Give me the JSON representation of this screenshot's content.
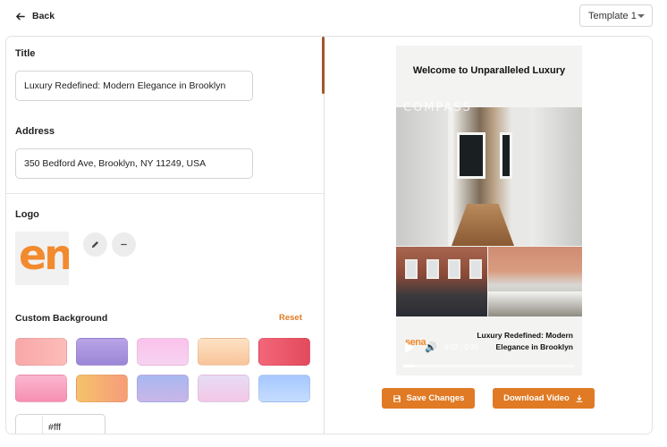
{
  "header": {
    "back_label": "Back",
    "template_value": "Template 1"
  },
  "form": {
    "title_label": "Title",
    "title_value": "Luxury Redefined: Modern Elegance in Brooklyn",
    "address_label": "Address",
    "address_value": "350 Bedford Ave, Brooklyn, NY 11249, USA",
    "logo_label": "Logo",
    "logo_text": "en",
    "custom_bg_label": "Custom Background",
    "reset_label": "Reset",
    "color_value": "#fff",
    "swatches": [
      "linear-gradient(90deg,#f7a8a8,#fdbcb8)",
      "linear-gradient(180deg,#b9a4e8,#9a86d6)",
      "linear-gradient(180deg,#fbc2eb,#f6d3f0)",
      "linear-gradient(180deg,#fde2c4,#f8c49a)",
      "linear-gradient(90deg,#f3667a,#e24b5c)",
      "linear-gradient(180deg,#fbb6ce,#f78fb3)",
      "linear-gradient(90deg,#f5c26b,#f79c7a)",
      "linear-gradient(180deg,#a8b8f0,#c9b5e8)",
      "linear-gradient(180deg,#e6dcf5,#f3c7e6)",
      "linear-gradient(180deg,#a6c8ff,#c5dcff)"
    ]
  },
  "preview": {
    "title": "Welcome to Unparalleled Luxury",
    "watermark": "COMPASS",
    "caption": "Luxury Redefined: Modern Elegance in Brooklyn",
    "logo_text": "sena",
    "time": "0:02 / 0:30",
    "progress": 0.07
  },
  "actions": {
    "save_label": "Save Changes",
    "download_label": "Download Video"
  },
  "colors": {
    "accent": "#e07a24"
  }
}
